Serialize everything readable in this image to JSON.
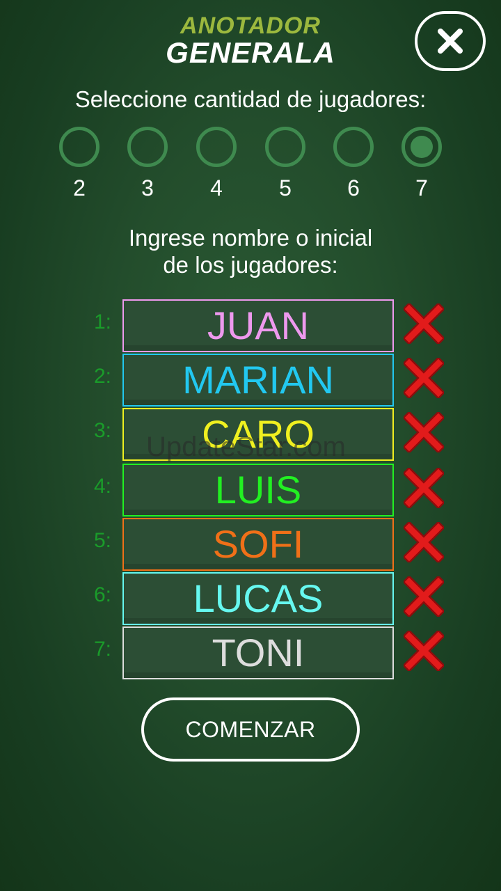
{
  "header": {
    "logo_top": "ANOTADOR",
    "logo_bottom": "GENERALA",
    "close_icon": "close-icon"
  },
  "player_count": {
    "title": "Seleccione cantidad de jugadores:",
    "options": [
      "2",
      "3",
      "4",
      "5",
      "6",
      "7"
    ],
    "selected": "7"
  },
  "names": {
    "title_line1": "Ingrese nombre o inicial",
    "title_line2": "de los jugadores:"
  },
  "players": [
    {
      "num": "1:",
      "name": "JUAN",
      "color": "#ee99ee"
    },
    {
      "num": "2:",
      "name": "MARIAN",
      "color": "#22c8f0"
    },
    {
      "num": "3:",
      "name": "CARO",
      "color": "#f0f020"
    },
    {
      "num": "4:",
      "name": "LUIS",
      "color": "#22f022"
    },
    {
      "num": "5:",
      "name": "SOFI",
      "color": "#f07018"
    },
    {
      "num": "6:",
      "name": "LUCAS",
      "color": "#66f8f0"
    },
    {
      "num": "7:",
      "name": "TONI",
      "color": "#dddddd"
    }
  ],
  "delete_icon": "red-x-icon",
  "watermark": "UpdateStar.com",
  "start_button": "COMENZAR",
  "colors": {
    "accent_green": "#3f8a4f",
    "number_green": "#1a9c2a",
    "logo_green": "#9cb83e",
    "delete_red": "#e21b1b"
  }
}
